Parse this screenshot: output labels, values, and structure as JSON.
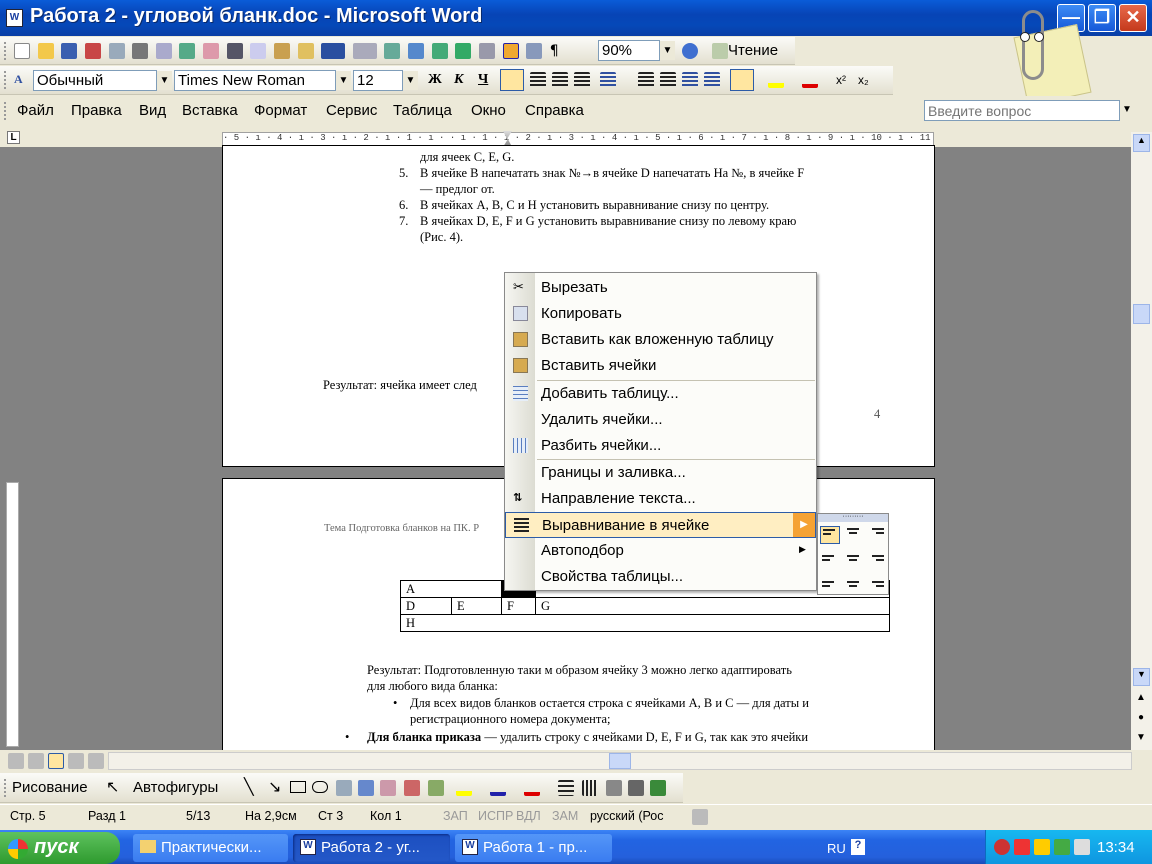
{
  "window": {
    "title": "Работа 2 - угловой бланк.doc - Microsoft Word",
    "min_label": "—",
    "max_label": "❐",
    "close_label": "✕"
  },
  "standard_toolbar": {
    "zoom": "90%",
    "reading_label": "Чтение"
  },
  "formatting_toolbar": {
    "style": "Обычный",
    "font": "Times New Roman",
    "size": "12",
    "bold": "Ж",
    "italic": "К",
    "underline": "Ч",
    "superscript": "x²",
    "subscript": "x₂"
  },
  "menu": {
    "items": [
      "Файл",
      "Правка",
      "Вид",
      "Вставка",
      "Формат",
      "Сервис",
      "Таблица",
      "Окно",
      "Справка"
    ],
    "ask_placeholder": "Введите вопрос"
  },
  "ruler": {
    "text": "· 5 · ı · 4 · ı · 3 · ı · 2 · ı · 1 · ı ·   · ı · 1 · ı · 2 · ı · 3 · ı · 4 · ı · 5 · ı · 6 · ı · 7 · ı · 8 · ı · 9 · ı · 10 · ı · 11 · ı · 12 · ı · 13 · ı ·    · 15 ·"
  },
  "page1": {
    "lines": [
      {
        "num": "",
        "text": "для ячеек C, E, G."
      },
      {
        "num": "5.",
        "text": "В ячейке B напечатать знак №→в ячейке D напечатать  На №, в ячейке F"
      },
      {
        "num": "",
        "text": "— предлог от."
      },
      {
        "num": "6.",
        "text": "В ячейках  A,   B,   C и  H установить выравнивание снизу по центру."
      },
      {
        "num": "7.",
        "text": "В ячейках  D, E, F и  G  установить выравнивание снизу по левому краю"
      },
      {
        "num": "",
        "text": "(Рис. 4)."
      }
    ],
    "result": "Результат: ячейка имеет след",
    "page_number": "4"
  },
  "page2": {
    "header": "Тема Подготовка бланков на ПК. Р",
    "table": {
      "row1": [
        "A",
        "",
        ""
      ],
      "row2": [
        "D",
        "E",
        "F",
        "G"
      ],
      "row3": [
        "H"
      ]
    },
    "result_line1": "Результат: Подготовленную таки м образом ячейку 3 можно легко адаптировать",
    "result_line2": "для любого вида бланка:",
    "bullet1_line1": "Для всех видов бланков остается строка с ячейками A, B и C — для даты и",
    "bullet1_line2": "регистрационного номера документа;",
    "bullet2_bold": "Для бланка приказа",
    "bullet2_rest": " — удалить строку с ячейками D, E, F и  G, так как это ячейки"
  },
  "context_menu": {
    "items": [
      "Вырезать",
      "Копировать",
      "Вставить как вложенную таблицу",
      "Вставить ячейки",
      "Добавить таблицу...",
      "Удалить ячейки...",
      "Разбить ячейки...",
      "Границы и заливка...",
      "Направление текста...",
      "Выравнивание в ячейке",
      "Автоподбор",
      "Свойства таблицы..."
    ],
    "highlighted": "Выравнивание в ячейке"
  },
  "drawing_toolbar": {
    "draw_label": "Рисование",
    "autoshapes_label": "Автофигуры"
  },
  "status": {
    "page": "Стр. 5",
    "section": "Разд 1",
    "pages": "5/13",
    "position": "На 2,9см",
    "line": "Ст 3",
    "column": "Кол 1",
    "rec": "ЗАП",
    "trk": "ИСПР",
    "ext": "ВДЛ",
    "ovr": "ЗАМ",
    "language": "русский (Рос"
  },
  "taskbar": {
    "start": "пуск",
    "tasks": [
      "Практически...",
      "Работа 2 - уг...",
      "Работа 1 - пр..."
    ],
    "lang": "RU",
    "time": "13:34"
  }
}
